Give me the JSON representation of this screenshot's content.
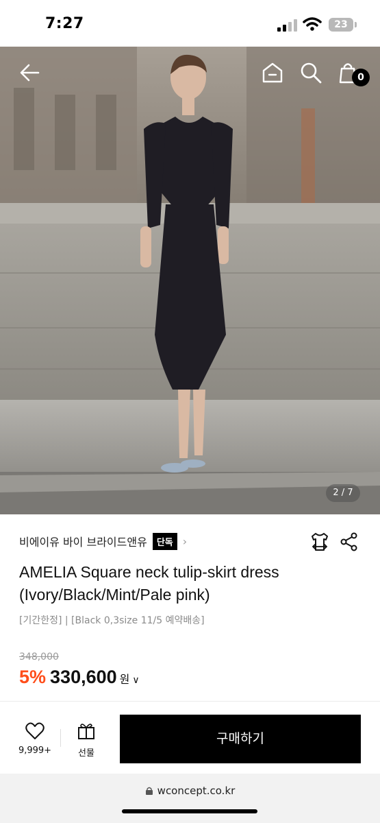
{
  "status_bar": {
    "time": "7:27",
    "battery": "23"
  },
  "hero": {
    "page_indicator": "2 / 7",
    "cart_count": "0"
  },
  "product": {
    "brand": "비에이유 바이 브라이드앤유",
    "exclusive_badge": "단독",
    "title": "AMELIA Square neck tulip-skirt dress (Ivory/Black/Mint/Pale pink)",
    "note": "[기간한정] | [Black 0,3size 11/5 예약배송]",
    "original_price": "348,000",
    "discount": "5%",
    "price": "330,600",
    "currency": "원"
  },
  "action_bar": {
    "wish_count": "9,999+",
    "gift_label": "선물",
    "buy_label": "구매하기"
  },
  "browser": {
    "url": "wconcept.co.kr"
  },
  "colors": {
    "discount": "#ff4e1b",
    "buy_button": "#000000"
  },
  "icons": [
    "back-arrow-icon",
    "home-icon",
    "search-icon",
    "shopping-bag-icon",
    "hanger-fit-icon",
    "share-icon",
    "heart-icon",
    "gift-icon",
    "lock-icon"
  ]
}
